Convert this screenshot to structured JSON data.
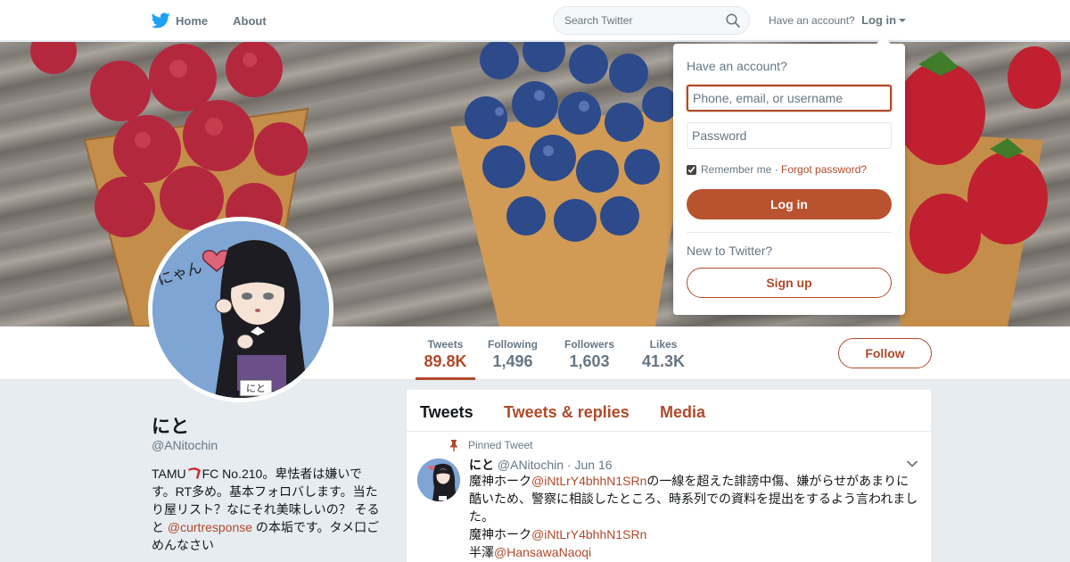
{
  "nav": {
    "home_label": "Home",
    "about_label": "About",
    "search_placeholder": "Search Twitter",
    "have_account": "Have an account?",
    "login_label": "Log in"
  },
  "colors": {
    "accent": "#b04a2a",
    "twitter_blue": "#1da1f2",
    "background": "#e6ecf0"
  },
  "icons": {
    "logo": "twitter-bird-icon",
    "search": "search-icon",
    "caret": "caret-down-icon",
    "pin": "pin-icon",
    "tweet_menu": "chevron-down-icon"
  },
  "stats": [
    {
      "label": "Tweets",
      "value": "89.8K"
    },
    {
      "label": "Following",
      "value": "1,496"
    },
    {
      "label": "Followers",
      "value": "1,603"
    },
    {
      "label": "Likes",
      "value": "41.3K"
    }
  ],
  "follow_label": "Follow",
  "profile": {
    "name": "にと",
    "handle": "@ANitochin",
    "bio_part1": "TAMU",
    "bio_part2": "FC No.210。卑怯者は嫌いです。RT多め。基本フォロバします。当たり屋リスト？なにそれ美味しいの？ そると ",
    "bio_mention": "@curtresponse",
    "bio_part3": " の本垢です。タメ口ごめんなさい",
    "avatar_text": "にゃん",
    "avatar_tag": "にと"
  },
  "timeline": {
    "tabs": [
      "Tweets",
      "Tweets & replies",
      "Media"
    ],
    "pinned_label": "Pinned Tweet",
    "tweet": {
      "name": "にと",
      "handle": "@ANitochin",
      "date": "Jun 16",
      "line1_prefix": "魔神ホーク",
      "line1_mention": "@iNtLrY4bhhN1SRn",
      "line1_rest": "の一線を超えた誹謗中傷、嫌がらせがあまりに酷いため、警察に相談したところ、時系列での資料を提出をするよう言われました。",
      "line2_prefix": "魔神ホーク",
      "line2_mention": "@iNtLrY4bhhN1SRn",
      "line3_prefix": "半澤",
      "line3_mention": "@HansawaNaoqi"
    }
  },
  "login_dropdown": {
    "title": "Have an account?",
    "username_placeholder": "Phone, email, or username",
    "password_placeholder": "Password",
    "remember_label": "Remember me",
    "separator": " · ",
    "forgot_label": "Forgot password?",
    "login_button": "Log in",
    "new_label": "New to Twitter?",
    "signup_button": "Sign up"
  }
}
